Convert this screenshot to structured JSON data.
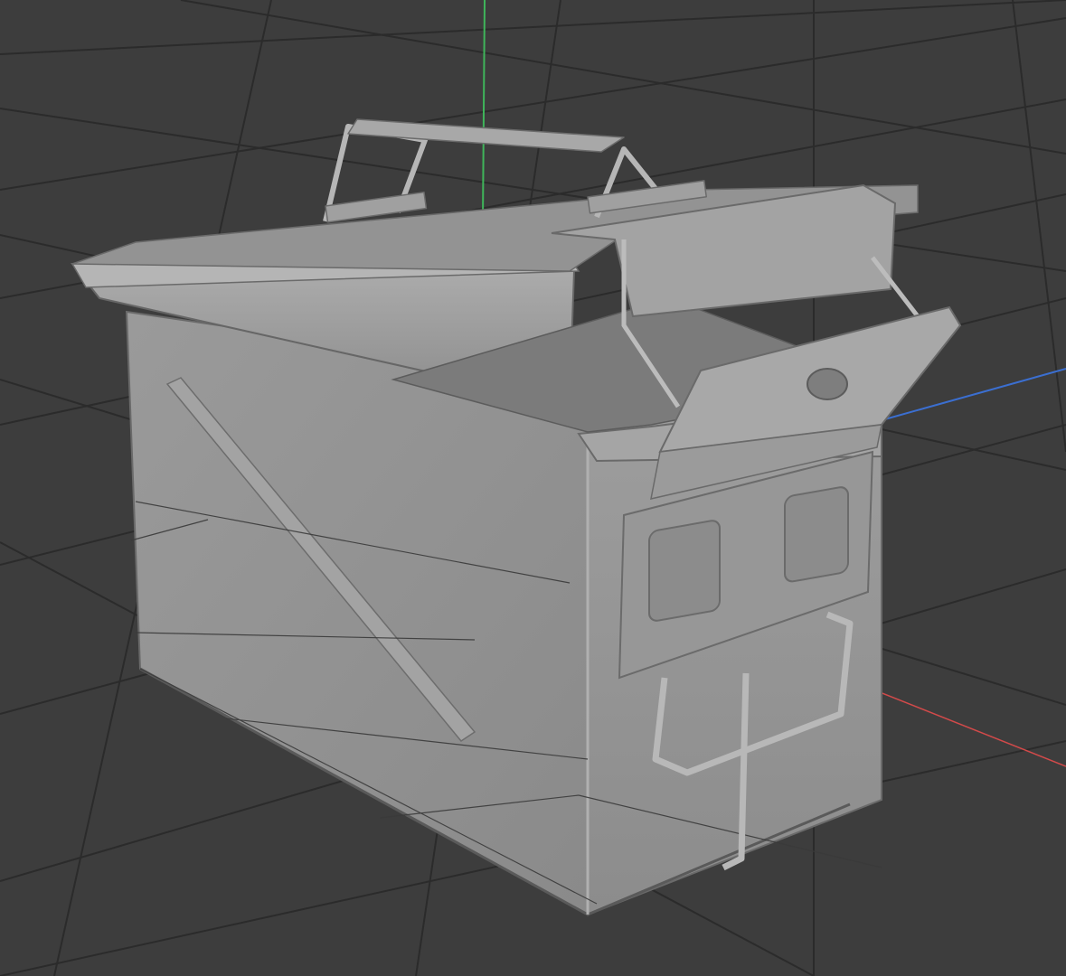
{
  "viewport": {
    "background": "#3d3d3d",
    "grid_color": "#2b2b2b",
    "axis_colors": {
      "x": "#d24a4a",
      "y": "#3fb55a",
      "z": "#3b6fd1"
    }
  },
  "object": {
    "type": "ammo-can",
    "base_color": "#8f8f8f",
    "shade_light": "#a9a9a9",
    "shade_dark": "#6a6a6a",
    "edge_color": "#5a5a5a"
  }
}
